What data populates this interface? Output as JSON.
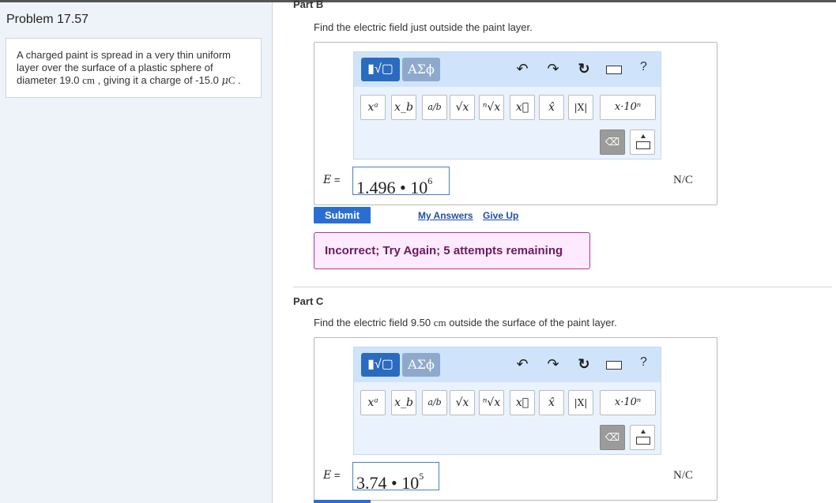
{
  "problem": {
    "title": "Problem 17.57",
    "text_a": "A charged paint is spread in a very thin uniform layer over the surface of a plastic sphere of diameter 19.0 ",
    "unit_cm": "cm",
    "text_b": " , giving it a charge of -15.0 ",
    "unit_mu": "μ",
    "unit_C": "C",
    "text_c": " ."
  },
  "toolbar": {
    "templates_label": "▮√▢",
    "greek_label": "ΑΣϕ",
    "undo": "↶",
    "redo": "↷",
    "reset": "↻",
    "help": "?",
    "buttons": [
      "xᵃ",
      "x_b",
      "a/b",
      "√x",
      "ⁿ√x",
      "x⃗",
      "x̂",
      "|X|",
      "x·10ⁿ"
    ],
    "delete_icon": "⌫"
  },
  "part_b": {
    "title": "Part B",
    "prompt": "Find the electric field just outside the paint layer.",
    "var_label": "E",
    "equals": " =",
    "answer_mantissa": "1.496 • 10",
    "answer_exp": "6",
    "units": "N/C",
    "submit": "Submit",
    "my_answers": "My Answers",
    "give_up": "Give Up",
    "feedback": "Incorrect; Try Again; 5 attempts remaining"
  },
  "part_c": {
    "title": "Part C",
    "prompt_a": "Find the electric field 9.50 ",
    "prompt_unit": "cm",
    "prompt_b": " outside the surface of the paint layer.",
    "var_label": "E",
    "equals": " =",
    "answer_mantissa": "3.74 • 10",
    "answer_exp": "5",
    "units": "N/C"
  },
  "colors": {
    "submit_bg": "#2a6ed4",
    "feedback_border": "#b3349b",
    "feedback_bg": "#fdeaff",
    "toolbar_bg": "#cfe4fa"
  }
}
